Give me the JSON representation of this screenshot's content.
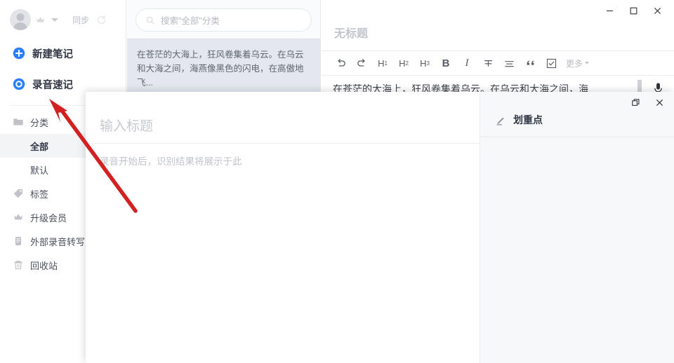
{
  "window": {
    "controls": [
      {
        "name": "minimize",
        "glyph": "minimize-icon"
      },
      {
        "name": "maximize",
        "glyph": "maximize-icon"
      },
      {
        "name": "close",
        "glyph": "close-icon"
      }
    ]
  },
  "sidebar": {
    "account": {
      "avatar_icon": "user-avatar-icon",
      "crown_icon": "crown-icon",
      "dropdown_icon": "chevron-down-icon",
      "sync_label": "同步",
      "sync_icon": "refresh-icon"
    },
    "actions": [
      {
        "label": "新建笔记",
        "icon": "plus-circle-icon",
        "color": "#2a7fff"
      },
      {
        "label": "录音速记",
        "icon": "record-circle-icon",
        "color": "#2a7fff"
      }
    ],
    "nav": [
      {
        "label": "分类",
        "icon": "folder-icon",
        "selected": false,
        "sub": false
      },
      {
        "label": "全部",
        "icon": "",
        "selected": true,
        "sub": true
      },
      {
        "label": "默认",
        "icon": "",
        "selected": false,
        "sub": true
      },
      {
        "label": "标签",
        "icon": "tag-icon",
        "selected": false,
        "sub": false
      },
      {
        "label": "升级会员",
        "icon": "crown-icon",
        "selected": false,
        "sub": false
      },
      {
        "label": "外部录音转写",
        "icon": "transcribe-icon",
        "selected": false,
        "sub": false
      },
      {
        "label": "回收站",
        "icon": "trash-icon",
        "selected": false,
        "sub": false
      }
    ]
  },
  "note_list": {
    "search": {
      "icon": "search-icon",
      "placeholder": "搜索\"全部\"分类"
    },
    "items": [
      {
        "preview": "在苍茫的大海上，狂风卷集着乌云。在乌云和大海之间，海燕像黑色的闪电，在高傲地飞...",
        "selected": true
      }
    ]
  },
  "editor": {
    "title": "无标题",
    "toolbar": [
      {
        "name": "undo",
        "label": "undo-icon"
      },
      {
        "name": "redo",
        "label": "redo-icon"
      },
      {
        "name": "heading-1",
        "label": "H",
        "sub": "1"
      },
      {
        "name": "heading-2",
        "label": "H",
        "sub": "2"
      },
      {
        "name": "heading-3",
        "label": "H",
        "sub": "3"
      },
      {
        "name": "bold",
        "label": "B"
      },
      {
        "name": "italic",
        "label": "I"
      },
      {
        "name": "strikethrough",
        "label": "strikethrough-icon"
      },
      {
        "name": "align",
        "label": "align-icon"
      },
      {
        "name": "quote",
        "label": "“"
      },
      {
        "name": "checklist",
        "label": "checkbox-icon"
      }
    ],
    "more_label": "更多",
    "content_line": "在苍茫的大海上，狂风卷集着乌云。在乌云和大海之间，海",
    "mic_icon": "microphone-icon"
  },
  "modal": {
    "controls": [
      {
        "name": "restore",
        "glyph": "restore-icon"
      },
      {
        "name": "close",
        "glyph": "close-icon"
      }
    ],
    "title_placeholder": "输入标题",
    "body_placeholder": "录音开始后，识别结果将展示于此",
    "right_panel": {
      "icon": "pen-icon",
      "label": "划重点"
    }
  },
  "annotation": {
    "arrow_color": "#d32020",
    "points_at": "录音速记"
  }
}
